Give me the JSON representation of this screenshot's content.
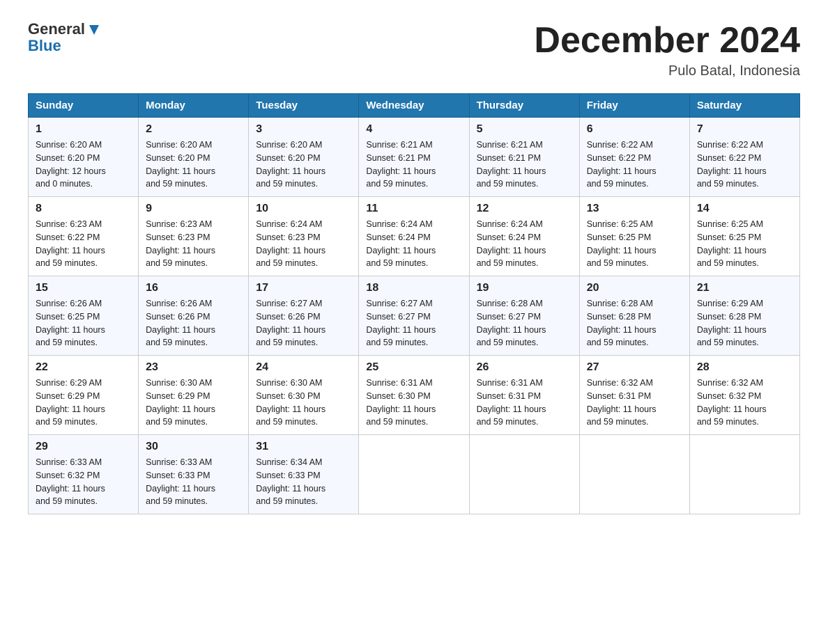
{
  "header": {
    "logo_general": "General",
    "logo_blue": "Blue",
    "month_title": "December 2024",
    "location": "Pulo Batal, Indonesia"
  },
  "days_of_week": [
    "Sunday",
    "Monday",
    "Tuesday",
    "Wednesday",
    "Thursday",
    "Friday",
    "Saturday"
  ],
  "weeks": [
    [
      {
        "day": "1",
        "sunrise": "6:20 AM",
        "sunset": "6:20 PM",
        "daylight": "12 hours and 0 minutes."
      },
      {
        "day": "2",
        "sunrise": "6:20 AM",
        "sunset": "6:20 PM",
        "daylight": "11 hours and 59 minutes."
      },
      {
        "day": "3",
        "sunrise": "6:20 AM",
        "sunset": "6:20 PM",
        "daylight": "11 hours and 59 minutes."
      },
      {
        "day": "4",
        "sunrise": "6:21 AM",
        "sunset": "6:21 PM",
        "daylight": "11 hours and 59 minutes."
      },
      {
        "day": "5",
        "sunrise": "6:21 AM",
        "sunset": "6:21 PM",
        "daylight": "11 hours and 59 minutes."
      },
      {
        "day": "6",
        "sunrise": "6:22 AM",
        "sunset": "6:22 PM",
        "daylight": "11 hours and 59 minutes."
      },
      {
        "day": "7",
        "sunrise": "6:22 AM",
        "sunset": "6:22 PM",
        "daylight": "11 hours and 59 minutes."
      }
    ],
    [
      {
        "day": "8",
        "sunrise": "6:23 AM",
        "sunset": "6:22 PM",
        "daylight": "11 hours and 59 minutes."
      },
      {
        "day": "9",
        "sunrise": "6:23 AM",
        "sunset": "6:23 PM",
        "daylight": "11 hours and 59 minutes."
      },
      {
        "day": "10",
        "sunrise": "6:24 AM",
        "sunset": "6:23 PM",
        "daylight": "11 hours and 59 minutes."
      },
      {
        "day": "11",
        "sunrise": "6:24 AM",
        "sunset": "6:24 PM",
        "daylight": "11 hours and 59 minutes."
      },
      {
        "day": "12",
        "sunrise": "6:24 AM",
        "sunset": "6:24 PM",
        "daylight": "11 hours and 59 minutes."
      },
      {
        "day": "13",
        "sunrise": "6:25 AM",
        "sunset": "6:25 PM",
        "daylight": "11 hours and 59 minutes."
      },
      {
        "day": "14",
        "sunrise": "6:25 AM",
        "sunset": "6:25 PM",
        "daylight": "11 hours and 59 minutes."
      }
    ],
    [
      {
        "day": "15",
        "sunrise": "6:26 AM",
        "sunset": "6:25 PM",
        "daylight": "11 hours and 59 minutes."
      },
      {
        "day": "16",
        "sunrise": "6:26 AM",
        "sunset": "6:26 PM",
        "daylight": "11 hours and 59 minutes."
      },
      {
        "day": "17",
        "sunrise": "6:27 AM",
        "sunset": "6:26 PM",
        "daylight": "11 hours and 59 minutes."
      },
      {
        "day": "18",
        "sunrise": "6:27 AM",
        "sunset": "6:27 PM",
        "daylight": "11 hours and 59 minutes."
      },
      {
        "day": "19",
        "sunrise": "6:28 AM",
        "sunset": "6:27 PM",
        "daylight": "11 hours and 59 minutes."
      },
      {
        "day": "20",
        "sunrise": "6:28 AM",
        "sunset": "6:28 PM",
        "daylight": "11 hours and 59 minutes."
      },
      {
        "day": "21",
        "sunrise": "6:29 AM",
        "sunset": "6:28 PM",
        "daylight": "11 hours and 59 minutes."
      }
    ],
    [
      {
        "day": "22",
        "sunrise": "6:29 AM",
        "sunset": "6:29 PM",
        "daylight": "11 hours and 59 minutes."
      },
      {
        "day": "23",
        "sunrise": "6:30 AM",
        "sunset": "6:29 PM",
        "daylight": "11 hours and 59 minutes."
      },
      {
        "day": "24",
        "sunrise": "6:30 AM",
        "sunset": "6:30 PM",
        "daylight": "11 hours and 59 minutes."
      },
      {
        "day": "25",
        "sunrise": "6:31 AM",
        "sunset": "6:30 PM",
        "daylight": "11 hours and 59 minutes."
      },
      {
        "day": "26",
        "sunrise": "6:31 AM",
        "sunset": "6:31 PM",
        "daylight": "11 hours and 59 minutes."
      },
      {
        "day": "27",
        "sunrise": "6:32 AM",
        "sunset": "6:31 PM",
        "daylight": "11 hours and 59 minutes."
      },
      {
        "day": "28",
        "sunrise": "6:32 AM",
        "sunset": "6:32 PM",
        "daylight": "11 hours and 59 minutes."
      }
    ],
    [
      {
        "day": "29",
        "sunrise": "6:33 AM",
        "sunset": "6:32 PM",
        "daylight": "11 hours and 59 minutes."
      },
      {
        "day": "30",
        "sunrise": "6:33 AM",
        "sunset": "6:33 PM",
        "daylight": "11 hours and 59 minutes."
      },
      {
        "day": "31",
        "sunrise": "6:34 AM",
        "sunset": "6:33 PM",
        "daylight": "11 hours and 59 minutes."
      },
      null,
      null,
      null,
      null
    ]
  ],
  "labels": {
    "sunrise": "Sunrise:",
    "sunset": "Sunset:",
    "daylight": "Daylight:"
  }
}
